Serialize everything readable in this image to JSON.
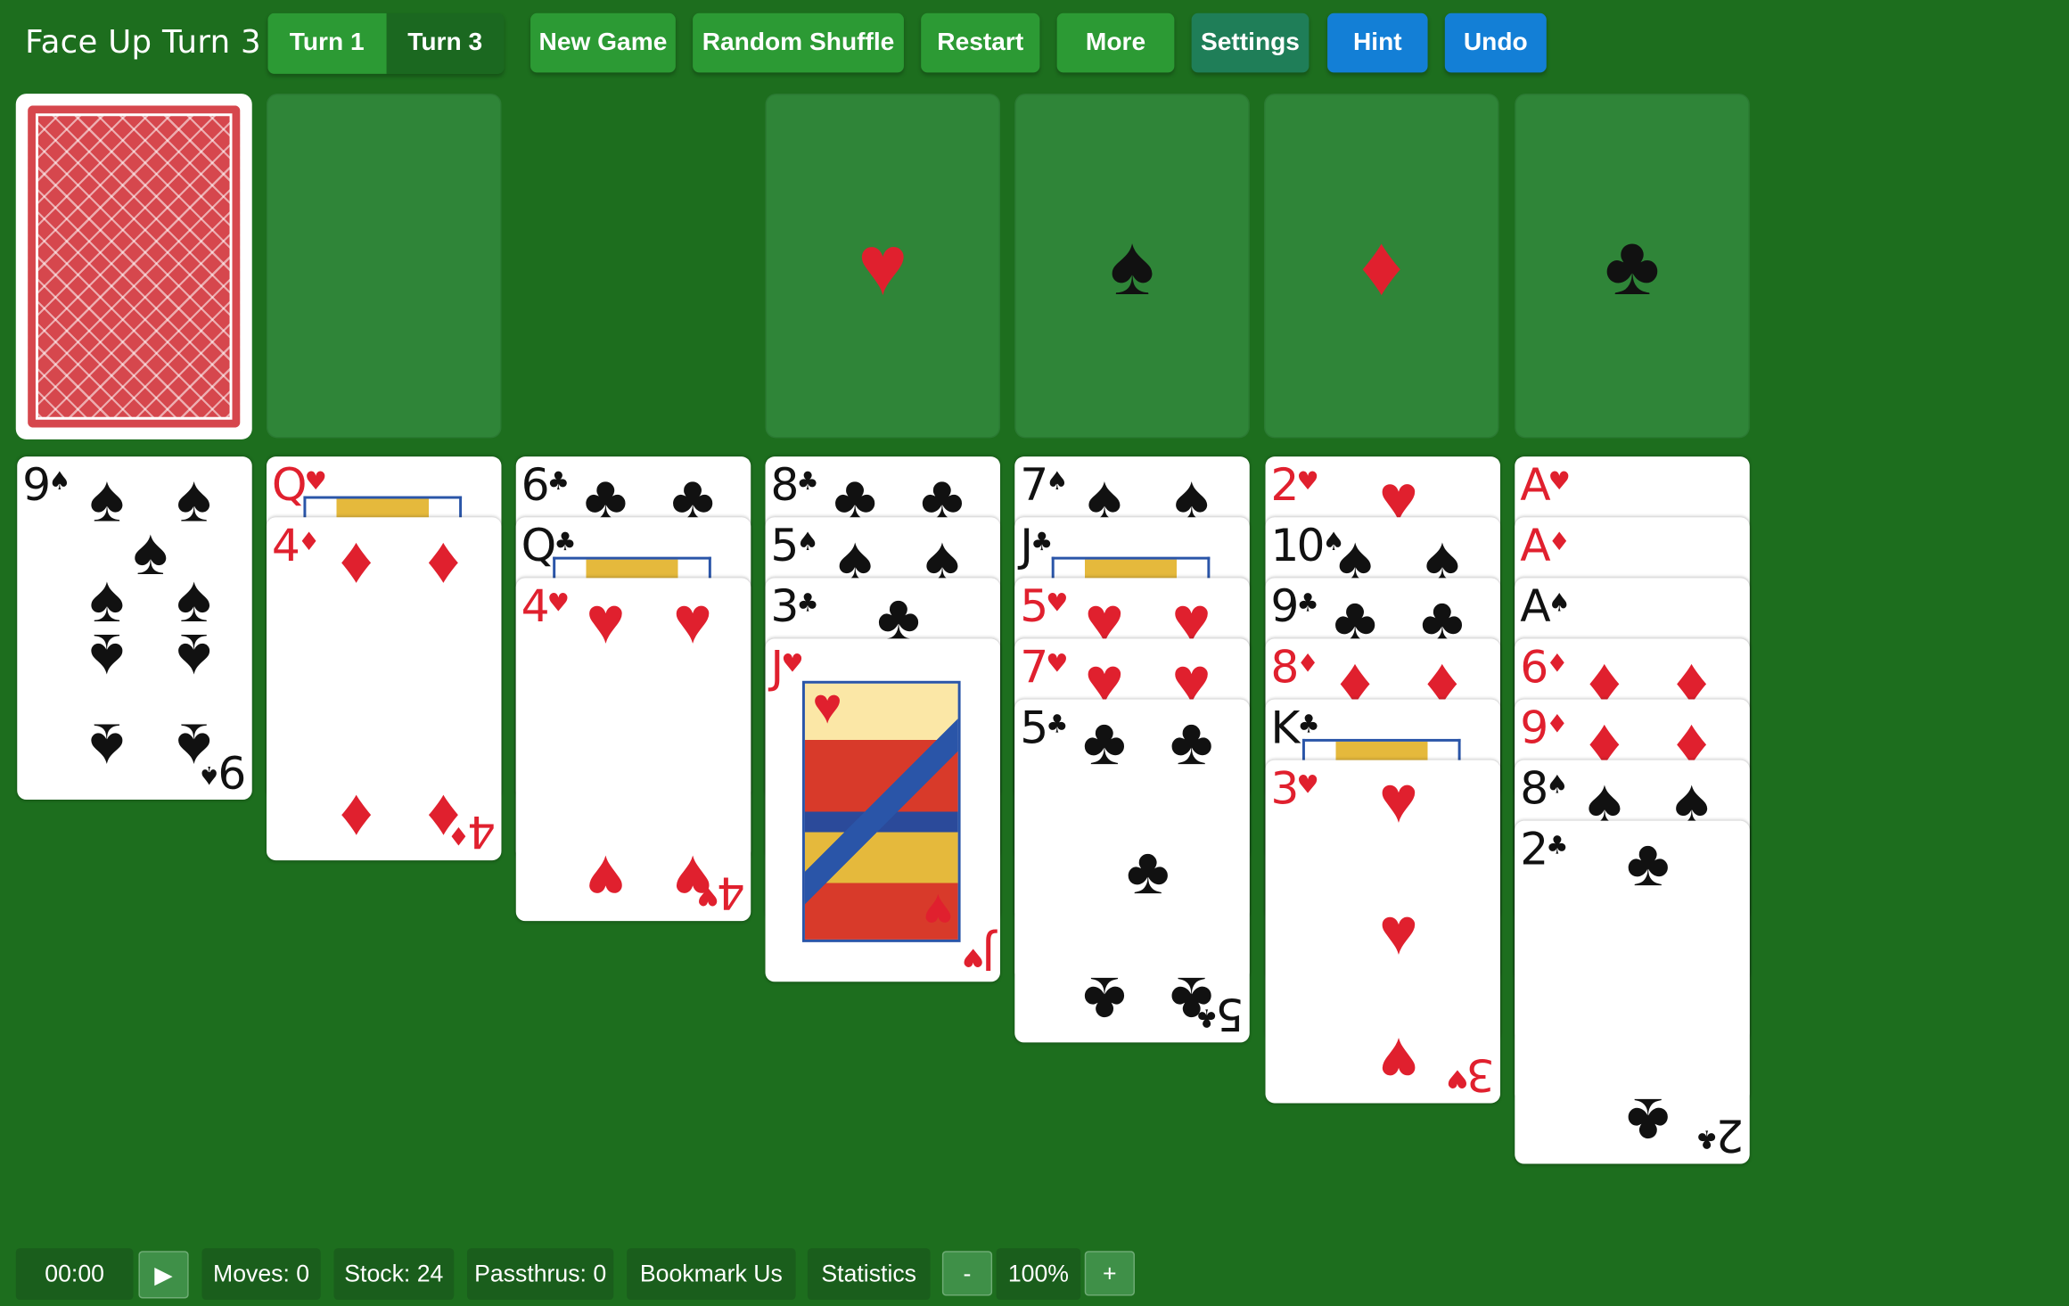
{
  "header": {
    "title": "Face Up Turn 3",
    "turn_options": [
      "Turn 1",
      "Turn 3"
    ],
    "buttons": {
      "new_game": "New Game",
      "random_shuffle": "Random Shuffle",
      "restart": "Restart",
      "more": "More",
      "settings": "Settings",
      "hint": "Hint",
      "undo": "Undo"
    }
  },
  "foundations": [
    {
      "suit": "hearts",
      "symbol": "♥",
      "color": "#e0202e"
    },
    {
      "suit": "spades",
      "symbol": "♠",
      "color": "#111111"
    },
    {
      "suit": "diamonds",
      "symbol": "♦",
      "color": "#e0202e"
    },
    {
      "suit": "clubs",
      "symbol": "♣",
      "color": "#111111"
    }
  ],
  "tableau": [
    [
      "9♠"
    ],
    [
      "Q♥",
      "4♦"
    ],
    [
      "6♣",
      "Q♣",
      "4♥"
    ],
    [
      "8♣",
      "5♠",
      "3♣",
      "J♥"
    ],
    [
      "7♠",
      "J♣",
      "5♥",
      "7♥",
      "5♣"
    ],
    [
      "2♥",
      "10♠",
      "9♣",
      "8♦",
      "K♣",
      "3♥"
    ],
    [
      "A♥",
      "A♦",
      "A♠",
      "6♦",
      "9♦",
      "8♠",
      "2♣"
    ]
  ],
  "footer": {
    "timer": "00:00",
    "play_icon": "▶",
    "moves": "Moves: 0",
    "stock": "Stock: 24",
    "passthrus": "Passthrus: 0",
    "bookmark": "Bookmark Us",
    "statistics": "Statistics",
    "zoom_minus": "-",
    "zoom": "100%",
    "zoom_plus": "+"
  },
  "colors": {
    "felt": "#1d6e1e",
    "red_suit": "#e0202e",
    "black_suit": "#111111",
    "button_green": "#2c9a34",
    "button_blue": "#137fd6",
    "button_teal": "#1f7e58"
  }
}
